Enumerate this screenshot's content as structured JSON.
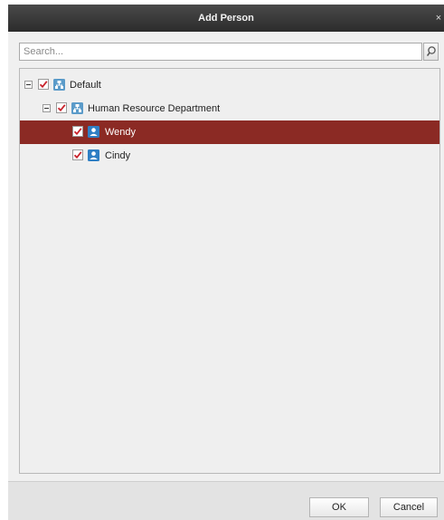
{
  "dialog": {
    "title": "Add Person",
    "close_glyph": "×",
    "close_icon": "close-icon"
  },
  "search": {
    "placeholder": "Search...",
    "value": "",
    "icon": "search-icon"
  },
  "tree": {
    "nodes": [
      {
        "label": "Default",
        "checked": true,
        "expanded": true,
        "icon": "organization-icon"
      },
      {
        "label": "Human Resource Department",
        "checked": true,
        "expanded": true,
        "icon": "department-icon"
      },
      {
        "label": "Wendy",
        "checked": true,
        "selected": true,
        "icon": "person-icon"
      },
      {
        "label": "Cindy",
        "checked": true,
        "selected": false,
        "icon": "person-icon"
      }
    ]
  },
  "buttons": {
    "ok_label": "OK",
    "cancel_label": "Cancel"
  },
  "colors": {
    "title_bar": "#3a3a3a",
    "selection": "#8b2a24",
    "check_mark": "#c8232c",
    "node_icon": "#2f7fc4"
  }
}
